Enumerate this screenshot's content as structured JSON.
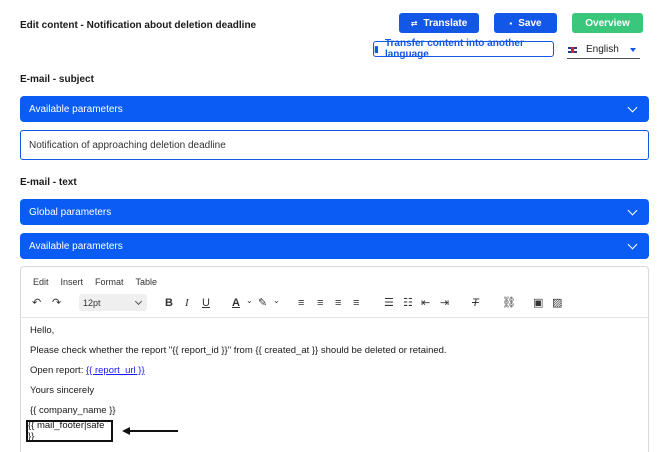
{
  "header": {
    "title": "Edit content - Notification about deletion deadline",
    "translate_label": "Translate",
    "save_label": "Save",
    "overview_label": "Overview",
    "transfer_label": "Transfer content into another language",
    "language": "English"
  },
  "subject": {
    "section_label": "E-mail - subject",
    "params_label": "Available parameters",
    "value": "Notification of approaching deletion deadline"
  },
  "text": {
    "section_label": "E-mail - text",
    "global_params_label": "Global parameters",
    "params_label": "Available parameters"
  },
  "editor": {
    "menu": [
      "Edit",
      "Insert",
      "Format",
      "Table"
    ],
    "font_size": "12pt",
    "lines": {
      "greeting": "Hello,",
      "report_check": "Please check whether the report \"{{ report_id }}\" from {{ created_at }} should be deleted or retained.",
      "open_report_prefix": "Open report: ",
      "open_report_link": "{{ report_url }}",
      "closing": "Yours sincerely",
      "company": "{{ company_name }}",
      "footer": "{{ mail_footer|safe }}"
    }
  },
  "colors": {
    "primary": "#1257e8",
    "bar": "#0a5cf5",
    "success": "#3ac77c"
  }
}
